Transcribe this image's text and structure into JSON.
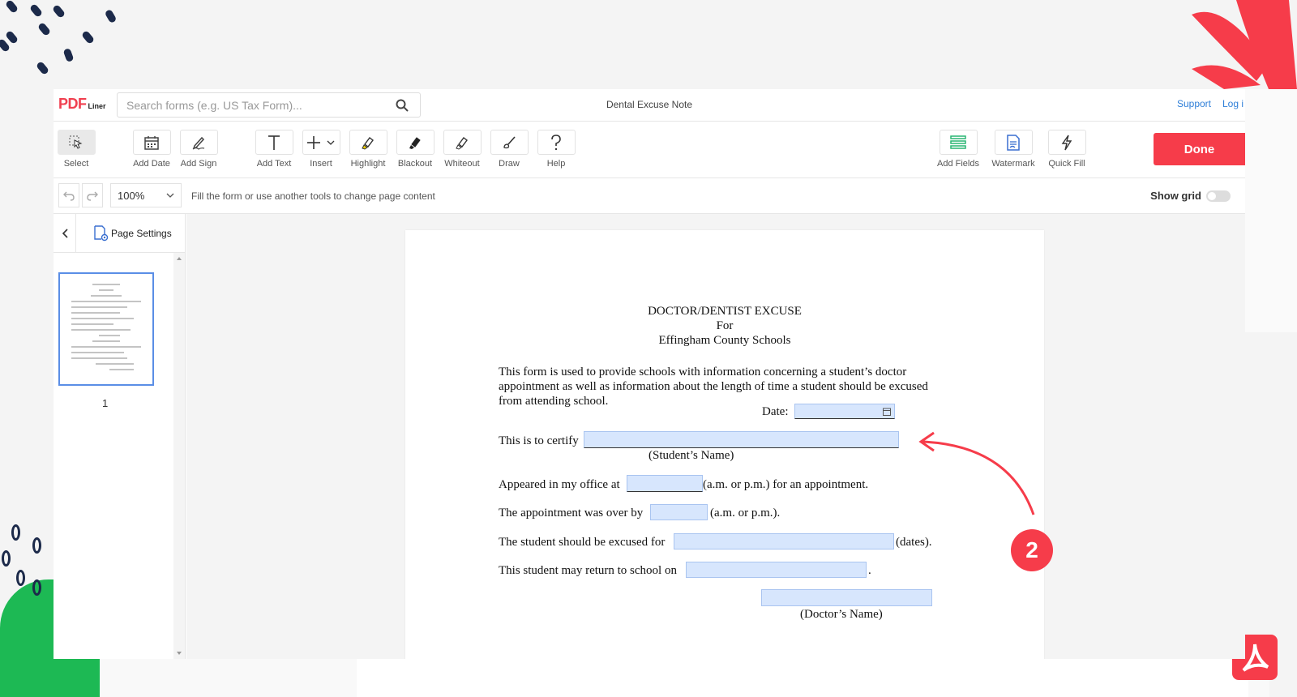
{
  "app": {
    "logo_main": "PDF",
    "logo_sub": "Liner",
    "search_placeholder": "Search forms (e.g. US Tax Form)...",
    "document_title": "Dental Excuse Note",
    "support_link": "Support",
    "login_link": "Log i"
  },
  "toolbar": {
    "select": "Select",
    "add_date": "Add Date",
    "add_sign": "Add Sign",
    "add_text": "Add Text",
    "insert": "Insert",
    "highlight": "Highlight",
    "blackout": "Blackout",
    "whiteout": "Whiteout",
    "draw": "Draw",
    "help": "Help",
    "add_fields": "Add Fields",
    "watermark": "Watermark",
    "quick_fill": "Quick Fill",
    "done": "Done"
  },
  "subbar": {
    "zoom": "100%",
    "hint": "Fill the form or use another tools to change page content",
    "show_grid": "Show grid"
  },
  "sidebar": {
    "page_settings": "Page Settings",
    "page_number": "1"
  },
  "document": {
    "heading_1": "DOCTOR/DENTIST EXCUSE",
    "heading_2": "For",
    "heading_3": "Effingham County Schools",
    "intro": "This form is used to provide schools with information concerning a student’s doctor appointment as well as information about the length of time a student should be excused from attending school.",
    "date_label": "Date:",
    "certify_label": "This is to certify",
    "student_name_caption": "(Student’s Name)",
    "appeared_label": "Appeared in my office at",
    "appeared_suffix": "(a.m. or p.m.) for an appointment.",
    "over_label": "The appointment was over by",
    "over_suffix": "(a.m. or p.m.).",
    "excused_label": "The student should be excused for",
    "excused_suffix": "(dates).",
    "return_label": "This student may return to school on",
    "return_suffix": ".",
    "doctor_name_caption": "(Doctor’s Name)"
  },
  "annotation": {
    "step_number": "2"
  },
  "colors": {
    "brand_red": "#f63c4a",
    "field_fill": "#d7e6fd",
    "link_blue": "#2f7fd8",
    "deco_green": "#1db954",
    "deco_navy": "#1c2a4a"
  }
}
